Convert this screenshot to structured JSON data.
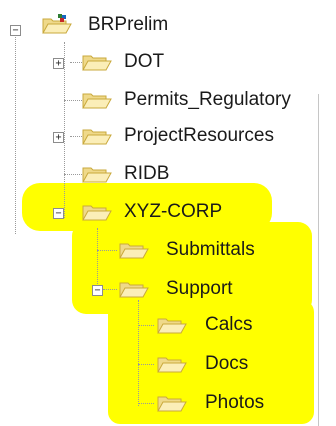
{
  "tree": {
    "root": {
      "label": "BRPrelim",
      "icon": "project-folder-icon",
      "expanded": true
    },
    "items": [
      {
        "label": "DOT",
        "icon": "folder-icon",
        "expandable": true,
        "expanded": false
      },
      {
        "label": "Permits_Regulatory",
        "icon": "folder-icon",
        "expandable": false
      },
      {
        "label": "ProjectResources",
        "icon": "folder-icon",
        "expandable": true,
        "expanded": false
      },
      {
        "label": "RIDB",
        "icon": "folder-icon",
        "expandable": false
      },
      {
        "label": "XYZ-CORP",
        "icon": "folder-icon",
        "expandable": true,
        "expanded": true,
        "children": [
          {
            "label": "Submittals",
            "icon": "folder-icon",
            "expandable": false
          },
          {
            "label": "Support",
            "icon": "folder-icon",
            "expandable": true,
            "expanded": true,
            "children": [
              {
                "label": "Calcs",
                "icon": "folder-icon"
              },
              {
                "label": "Docs",
                "icon": "folder-icon"
              },
              {
                "label": "Photos",
                "icon": "folder-icon"
              }
            ]
          }
        ]
      }
    ]
  },
  "symbols": {
    "collapsed": "+",
    "expanded": "−"
  },
  "colors": {
    "highlight": "#ffff00",
    "folder_fill": "#f5e6a0",
    "folder_stroke": "#c9a93c",
    "line": "#9a9a9a"
  }
}
